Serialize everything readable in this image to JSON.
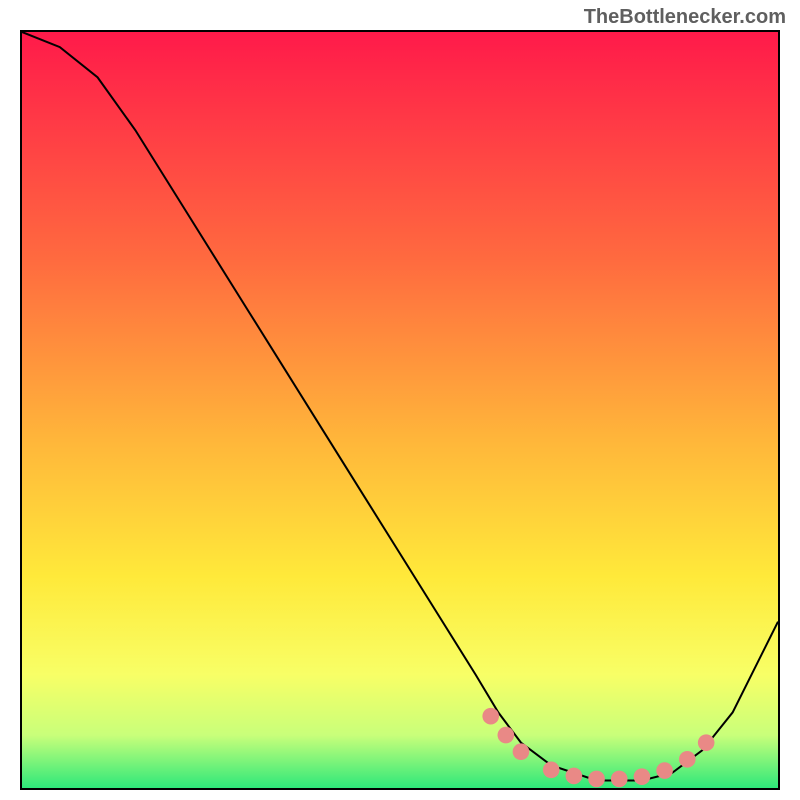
{
  "watermark": "TheBottlenecker.com",
  "chart_data": {
    "type": "line",
    "title": "",
    "xlabel": "",
    "ylabel": "",
    "xlim": [
      0,
      100
    ],
    "ylim": [
      0,
      100
    ],
    "background_gradient": {
      "top_color": "#ff1a4a",
      "mid1_color": "#ff8c3a",
      "mid2_color": "#ffe93a",
      "bottom_color": "#2ee87a"
    },
    "series": [
      {
        "name": "bottleneck-curve",
        "color": "#000000",
        "x": [
          0,
          5,
          10,
          15,
          20,
          25,
          30,
          35,
          40,
          45,
          50,
          55,
          60,
          63,
          66,
          70,
          76,
          82,
          86,
          90,
          94,
          100
        ],
        "y": [
          100,
          98,
          94,
          87,
          79,
          71,
          63,
          55,
          47,
          39,
          31,
          23,
          15,
          10,
          6,
          3,
          1,
          1,
          2,
          5,
          10,
          22
        ]
      }
    ],
    "markers": {
      "name": "highlight-points",
      "color": "#e98986",
      "points": [
        {
          "x": 62,
          "y": 9.5
        },
        {
          "x": 64,
          "y": 7.0
        },
        {
          "x": 66,
          "y": 4.8
        },
        {
          "x": 70,
          "y": 2.4
        },
        {
          "x": 73,
          "y": 1.6
        },
        {
          "x": 76,
          "y": 1.2
        },
        {
          "x": 79,
          "y": 1.2
        },
        {
          "x": 82,
          "y": 1.5
        },
        {
          "x": 85,
          "y": 2.3
        },
        {
          "x": 88,
          "y": 3.8
        },
        {
          "x": 90.5,
          "y": 6.0
        }
      ]
    }
  }
}
